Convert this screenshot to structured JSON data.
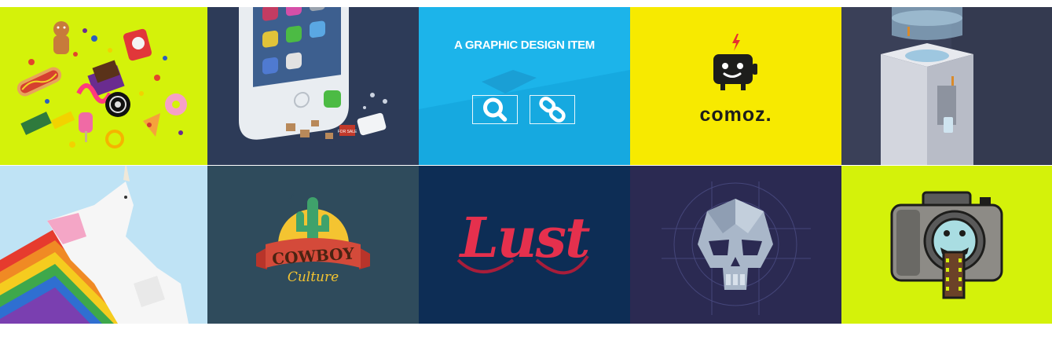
{
  "portfolio": {
    "hover_item": {
      "title": "A GRAPHIC DESIGN ITEM",
      "zoom_icon": "search-icon",
      "link_icon": "link-icon"
    },
    "tiles": [
      {
        "name": "candy-sweets",
        "bg": "#d4f20a"
      },
      {
        "name": "iphone-isometric",
        "bg": "#2d3b58",
        "texts": {
          "sign": "FOR SALE"
        }
      },
      {
        "name": "graphic-design-item",
        "bg": "#1cb4ea"
      },
      {
        "name": "comoz-logo",
        "bg": "#f7ea00",
        "texts": {
          "brand": "comoz."
        }
      },
      {
        "name": "water-cooler",
        "bg": "#343a50"
      },
      {
        "name": "unicorn-rainbow",
        "bg": "#bfe3f5"
      },
      {
        "name": "cowboy-culture",
        "bg": "#2f4b5c",
        "texts": {
          "line1": "COWBOY",
          "line2": "Culture"
        }
      },
      {
        "name": "lust-lettering",
        "bg": "#0d2d55",
        "texts": {
          "word": "Lust"
        }
      },
      {
        "name": "low-poly-skull",
        "bg": "#2b2a52"
      },
      {
        "name": "camera-monster",
        "bg": "#d4f20a"
      }
    ]
  }
}
